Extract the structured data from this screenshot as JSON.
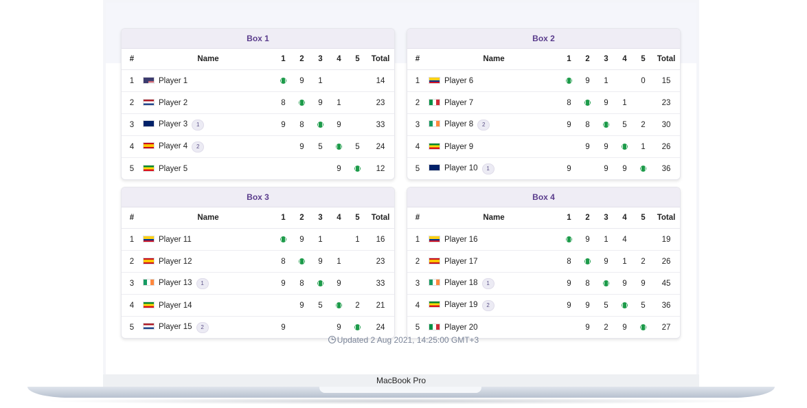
{
  "columns": {
    "idx": "#",
    "name": "Name",
    "games": [
      "1",
      "2",
      "3",
      "4",
      "5"
    ],
    "total": "Total"
  },
  "boxes": [
    {
      "title": "Box 1",
      "rows": [
        {
          "idx": "1",
          "flag": "us",
          "name": "Player 1",
          "badge": "",
          "games": [
            "ball",
            "9",
            "1",
            "",
            ""
          ],
          "total": "14"
        },
        {
          "idx": "2",
          "flag": "nl",
          "name": "Player 2",
          "badge": "",
          "games": [
            "8",
            "ball",
            "9",
            "1",
            ""
          ],
          "total": "23"
        },
        {
          "idx": "3",
          "flag": "gb",
          "name": "Player 3",
          "badge": "1",
          "games": [
            "9",
            "8",
            "ball",
            "9",
            ""
          ],
          "total": "33"
        },
        {
          "idx": "4",
          "flag": "es",
          "name": "Player 4",
          "badge": "2",
          "games": [
            "",
            "9",
            "5",
            "ball",
            "5"
          ],
          "total": "24"
        },
        {
          "idx": "5",
          "flag": "et",
          "name": "Player 5",
          "badge": "",
          "games": [
            "",
            "",
            "",
            "9",
            "ball"
          ],
          "total": "12"
        }
      ]
    },
    {
      "title": "Box 2",
      "rows": [
        {
          "idx": "1",
          "flag": "co",
          "name": "Player 6",
          "badge": "",
          "games": [
            "ball",
            "9",
            "1",
            "",
            "0"
          ],
          "total": "15"
        },
        {
          "idx": "2",
          "flag": "it",
          "name": "Player 7",
          "badge": "",
          "games": [
            "8",
            "ball",
            "9",
            "1",
            ""
          ],
          "total": "23"
        },
        {
          "idx": "3",
          "flag": "ie",
          "name": "Player 8",
          "badge": "2",
          "games": [
            "9",
            "8",
            "ball",
            "5",
            "2"
          ],
          "total": "30"
        },
        {
          "idx": "4",
          "flag": "et",
          "name": "Player 9",
          "badge": "",
          "games": [
            "",
            "9",
            "9",
            "ball",
            "1"
          ],
          "total": "26"
        },
        {
          "idx": "5",
          "flag": "nz",
          "name": "Player 10",
          "badge": "1",
          "games": [
            "9",
            "",
            "9",
            "9",
            "ball"
          ],
          "total": "36"
        }
      ]
    },
    {
      "title": "Box 3",
      "rows": [
        {
          "idx": "1",
          "flag": "co",
          "name": "Player 11",
          "badge": "",
          "games": [
            "ball",
            "9",
            "1",
            "",
            "1"
          ],
          "total": "16"
        },
        {
          "idx": "2",
          "flag": "es",
          "name": "Player 12",
          "badge": "",
          "games": [
            "8",
            "ball",
            "9",
            "1",
            ""
          ],
          "total": "23"
        },
        {
          "idx": "3",
          "flag": "ie",
          "name": "Player 13",
          "badge": "1",
          "games": [
            "9",
            "8",
            "ball",
            "9",
            ""
          ],
          "total": "33"
        },
        {
          "idx": "4",
          "flag": "et",
          "name": "Player 14",
          "badge": "",
          "games": [
            "",
            "9",
            "5",
            "ball",
            "2"
          ],
          "total": "21"
        },
        {
          "idx": "5",
          "flag": "nl",
          "name": "Player 15",
          "badge": "2",
          "games": [
            "9",
            "",
            "",
            "9",
            "ball"
          ],
          "total": "24"
        }
      ]
    },
    {
      "title": "Box 4",
      "rows": [
        {
          "idx": "1",
          "flag": "co",
          "name": "Player 16",
          "badge": "",
          "games": [
            "ball",
            "9",
            "1",
            "4",
            ""
          ],
          "total": "19"
        },
        {
          "idx": "2",
          "flag": "es",
          "name": "Player 17",
          "badge": "",
          "games": [
            "8",
            "ball",
            "9",
            "1",
            "2"
          ],
          "total": "26"
        },
        {
          "idx": "3",
          "flag": "ie",
          "name": "Player 18",
          "badge": "1",
          "games": [
            "9",
            "8",
            "ball",
            "9",
            "9"
          ],
          "total": "45"
        },
        {
          "idx": "4",
          "flag": "et",
          "name": "Player 19",
          "badge": "2",
          "games": [
            "9",
            "9",
            "5",
            "ball",
            "5"
          ],
          "total": "36"
        },
        {
          "idx": "5",
          "flag": "it",
          "name": "Player 20",
          "badge": "",
          "games": [
            "",
            "9",
            "2",
            "9",
            "ball"
          ],
          "total": "27"
        }
      ]
    }
  ],
  "updated": "Updated 2 Aug 2021, 14:25:00 GMT+3",
  "device_label": "MacBook Pro",
  "colors": {
    "accent": "#5a3c8c",
    "ball": "#1d9b4a",
    "header_bg": "#efedf5"
  }
}
